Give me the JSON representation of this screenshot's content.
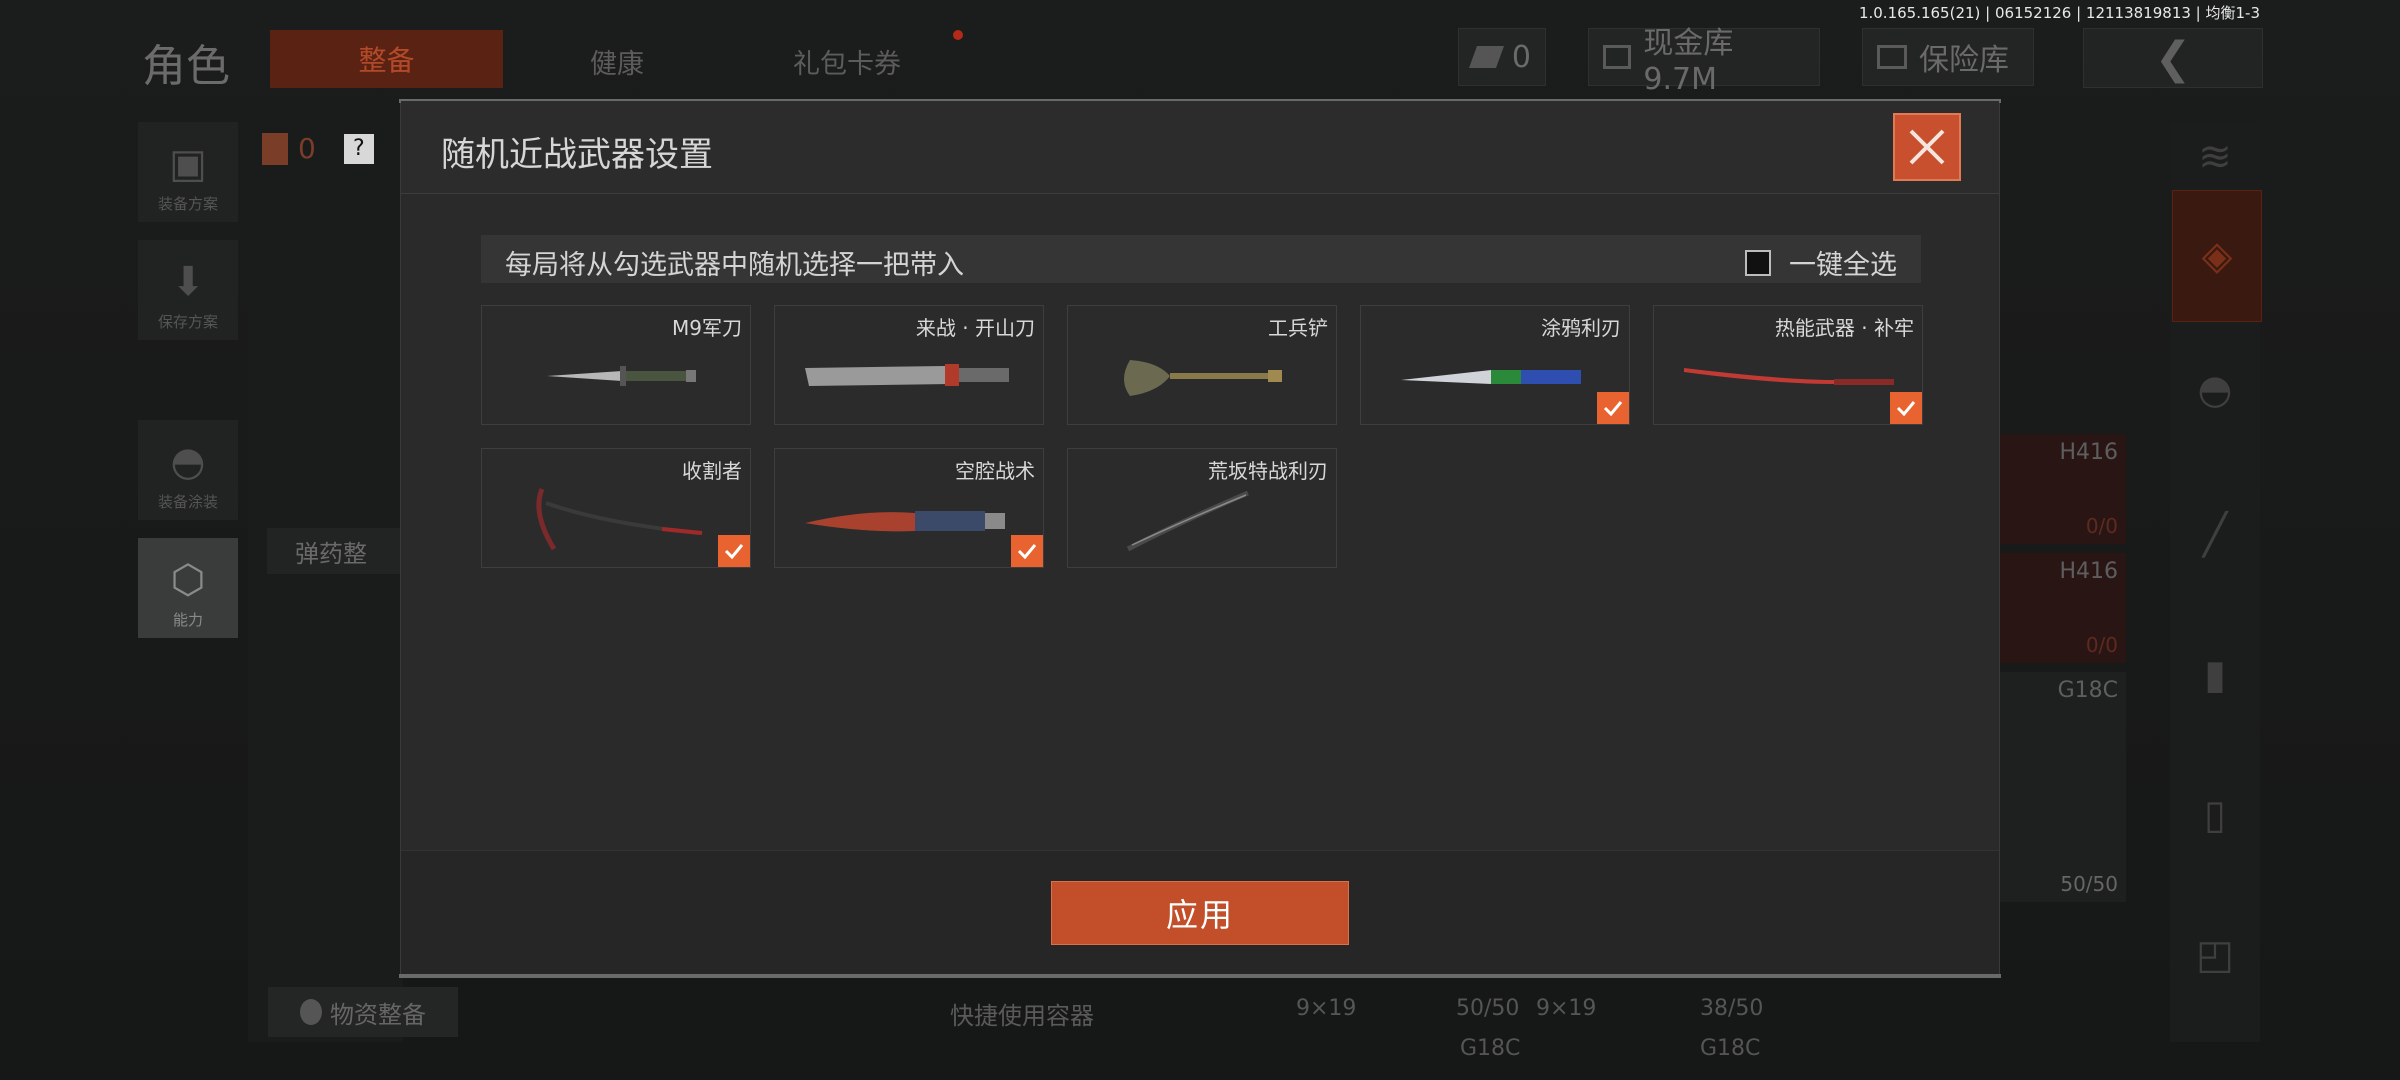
{
  "version": "1.0.165.165(21) | 06152126 | 12113819813 | 均衡1-3",
  "header": {
    "title": "角色",
    "tabs": [
      {
        "label": "整备",
        "active": true
      },
      {
        "label": "健康",
        "active": false
      },
      {
        "label": "礼包卡券",
        "active": false
      }
    ],
    "currency_count": "0",
    "cash_vault": "现金库 9.7M",
    "insurance": "保险库"
  },
  "sidebar": {
    "items": [
      {
        "label": "装备方案",
        "icon": "vest-icon"
      },
      {
        "label": "保存方案",
        "icon": "download-icon"
      },
      {
        "label": "装备涂装",
        "icon": "helmet-icon"
      },
      {
        "label": "能力",
        "icon": "ability-icon"
      }
    ]
  },
  "left_panel": {
    "backpack_count": "0",
    "help": "?",
    "ammo_button": "弹药整",
    "supply_button": "物资整备",
    "quick_use": "快捷使用容器"
  },
  "right_slots": [
    {
      "name": "H416",
      "count": "0/0"
    },
    {
      "name": "H416",
      "count": "0/0"
    },
    {
      "name": "G18C",
      "count": "50/50"
    }
  ],
  "bottom_cells": [
    {
      "caliber": "9×19",
      "count": "50/50",
      "name": "G18C"
    },
    {
      "caliber": "9×19",
      "count": "38/50",
      "name": "G18C"
    }
  ],
  "modal": {
    "title": "随机近战武器设置",
    "info": "每局将从勾选武器中随机选择一把带入",
    "select_all": "一键全选",
    "apply": "应用",
    "weapons": [
      {
        "name": "M9军刀",
        "checked": false
      },
      {
        "name": "来战 · 开山刀",
        "checked": false
      },
      {
        "name": "工兵铲",
        "checked": false
      },
      {
        "name": "涂鸦利刃",
        "checked": true
      },
      {
        "name": "热能武器 · 补牢",
        "checked": true
      },
      {
        "name": "收割者",
        "checked": true
      },
      {
        "name": "空腔战术",
        "checked": true
      },
      {
        "name": "荒坂特战利刃",
        "checked": false
      }
    ]
  },
  "colors": {
    "accent": "#e8632f",
    "apply_button": "#c24e2a",
    "close_button": "#c9502e"
  }
}
